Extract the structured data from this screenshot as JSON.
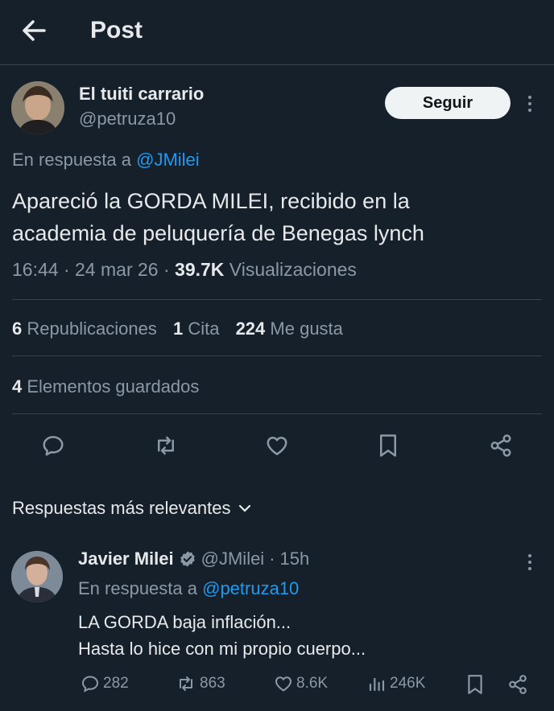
{
  "header": {
    "title": "Post",
    "back_icon": "arrow-left-icon"
  },
  "post": {
    "author_name": "El tuiti carrario",
    "author_handle": "@petruza10",
    "follow_label": "Seguir",
    "reply_prefix": "En respuesta a",
    "reply_to": "@JMilei",
    "text_line1": "Apareció la GORDA MILEI, recibido en la",
    "text_line2": "academia de peluquería de Benegas lynch",
    "time": "16:44",
    "date": "24 mar 26",
    "views_count": "39.7K",
    "views_label": "Visualizaciones",
    "reposts_count": "6",
    "reposts_label": "Republicaciones",
    "quotes_count": "1",
    "quotes_label": "Cita",
    "likes_count": "224",
    "likes_label": "Me gusta",
    "bookmarks_count": "4",
    "bookmarks_label": "Elementos guardados"
  },
  "replies_section": {
    "label": "Respuestas más relevantes"
  },
  "reply": {
    "author_name": "Javier Milei",
    "author_handle": "@JMilei",
    "time_ago": "15h",
    "reply_prefix": "En respuesta a",
    "reply_to": "@petruza10",
    "text_line1": "LA GORDA baja inflación...",
    "text_line2": "Hasta lo hice con mi propio cuerpo...",
    "replies": "282",
    "reposts": "863",
    "likes": "8.6K",
    "views": "246K"
  },
  "colors": {
    "background": "#15202b",
    "accent": "#1d9bf0",
    "verified": "#8b98a5"
  }
}
